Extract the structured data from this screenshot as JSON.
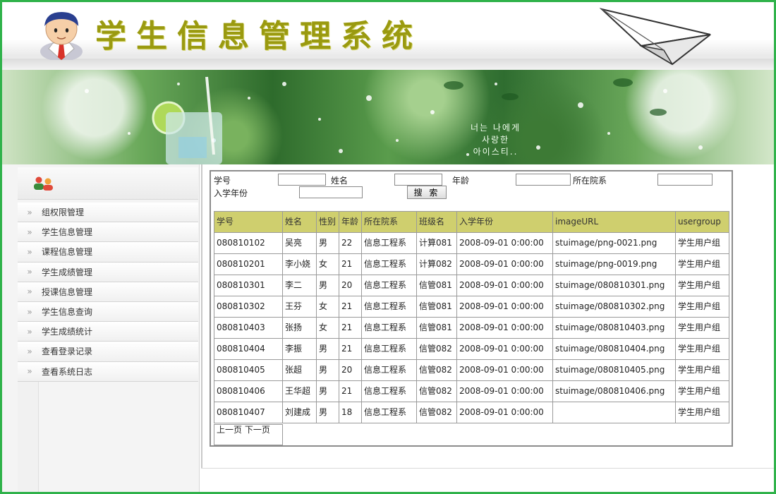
{
  "header": {
    "title": "学生信息管理系统",
    "icons": {
      "avatar": "user-avatar-icon",
      "plane": "paper-plane-icon"
    }
  },
  "banner": {
    "text_line1": "너는 나에게",
    "text_line2": "사랑한",
    "text_line3": "아이스티.."
  },
  "sidebar": {
    "header_icon": "users-icon",
    "items": [
      {
        "label": "组权限管理"
      },
      {
        "label": "学生信息管理"
      },
      {
        "label": "课程信息管理"
      },
      {
        "label": "学生成绩管理"
      },
      {
        "label": "授课信息管理"
      },
      {
        "label": "学生信息查询"
      },
      {
        "label": "学生成绩统计"
      },
      {
        "label": "查看登录记录"
      },
      {
        "label": "查看系统日志"
      }
    ]
  },
  "search": {
    "student_no_label": "学号",
    "name_label": "姓名",
    "age_label": "年龄",
    "department_label": "所在院系",
    "enroll_year_label": "入学年份",
    "search_button": "搜 索",
    "student_no_value": "",
    "name_value": "",
    "age_value": "",
    "department_value": "",
    "enroll_year_value": ""
  },
  "table": {
    "columns": [
      "学号",
      "姓名",
      "性别",
      "年龄",
      "所在院系",
      "班级名",
      "入学年份",
      "imageURL",
      "usergroup"
    ],
    "rows": [
      [
        "080810102",
        "吴亮",
        "男",
        "22",
        "信息工程系",
        "计算081",
        "2008-09-01 0:00:00",
        "stuimage/png-0021.png",
        "学生用户组"
      ],
      [
        "080810201",
        "李小娆",
        "女",
        "21",
        "信息工程系",
        "计算082",
        "2008-09-01 0:00:00",
        "stuimage/png-0019.png",
        "学生用户组"
      ],
      [
        "080810301",
        "李二",
        "男",
        "20",
        "信息工程系",
        "信管081",
        "2008-09-01 0:00:00",
        "stuimage/080810301.png",
        "学生用户组"
      ],
      [
        "080810302",
        "王芬",
        "女",
        "21",
        "信息工程系",
        "信管081",
        "2008-09-01 0:00:00",
        "stuimage/080810302.png",
        "学生用户组"
      ],
      [
        "080810403",
        "张扬",
        "女",
        "21",
        "信息工程系",
        "信管081",
        "2008-09-01 0:00:00",
        "stuimage/080810403.png",
        "学生用户组"
      ],
      [
        "080810404",
        "李振",
        "男",
        "21",
        "信息工程系",
        "信管082",
        "2008-09-01 0:00:00",
        "stuimage/080810404.png",
        "学生用户组"
      ],
      [
        "080810405",
        "张超",
        "男",
        "20",
        "信息工程系",
        "信管082",
        "2008-09-01 0:00:00",
        "stuimage/080810405.png",
        "学生用户组"
      ],
      [
        "080810406",
        "王华超",
        "男",
        "21",
        "信息工程系",
        "信管082",
        "2008-09-01 0:00:00",
        "stuimage/080810406.png",
        "学生用户组"
      ],
      [
        "080810407",
        "刘建成",
        "男",
        "18",
        "信息工程系",
        "信管082",
        "2008-09-01 0:00:00",
        "",
        "学生用户组"
      ]
    ]
  },
  "pager": {
    "prev": "上一页",
    "next": "下一页"
  },
  "colors": {
    "frame_border": "#2fb24a",
    "table_header_bg": "#cfcf6e",
    "title_color": "#9a9a10"
  }
}
